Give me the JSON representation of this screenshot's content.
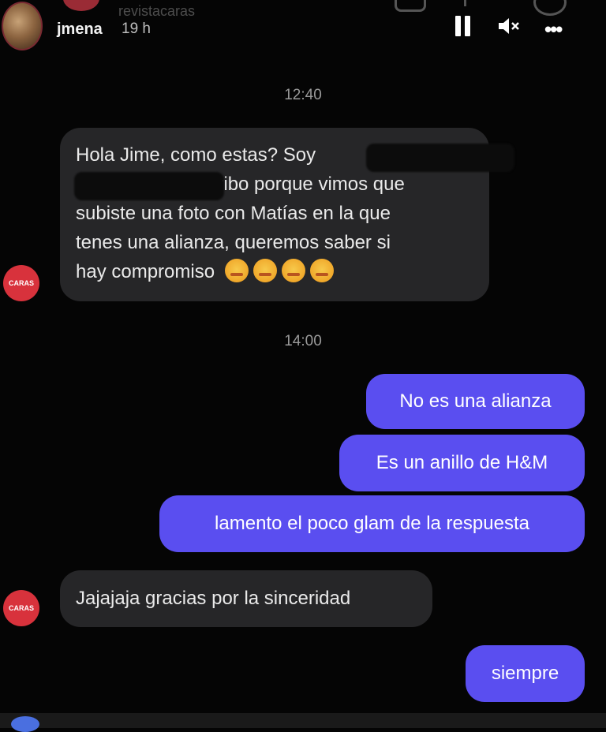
{
  "story": {
    "username": "jmena",
    "time_ago": "19 h",
    "ghost_username": "revistacaras",
    "controls": {
      "pause": "pause",
      "mute": "mute",
      "more": "•••"
    }
  },
  "chat": {
    "timestamp1": "12:40",
    "timestamp2": "14:00",
    "sender_avatar_label": "CARAS",
    "incoming1": {
      "line1": "Hola Jime, como estas? Soy",
      "line2": "Te escribo porque vimos que",
      "line3": "subiste una foto con Matías en la que",
      "line4": "tenes una alianza, queremos saber si",
      "line5": "hay compromiso",
      "emoji": "face-exhaling-emoji"
    },
    "outgoing": [
      "No es una alianza",
      "Es un anillo de H&M",
      "lamento el poco glam de la respuesta"
    ],
    "incoming2": "Jajajaja gracias por la sinceridad",
    "outgoing_last": "siempre"
  },
  "colors": {
    "background": "#050505",
    "incoming_bubble": "#262628",
    "outgoing_bubble": "#5a4ef0",
    "avatar_red": "#d8323c"
  }
}
